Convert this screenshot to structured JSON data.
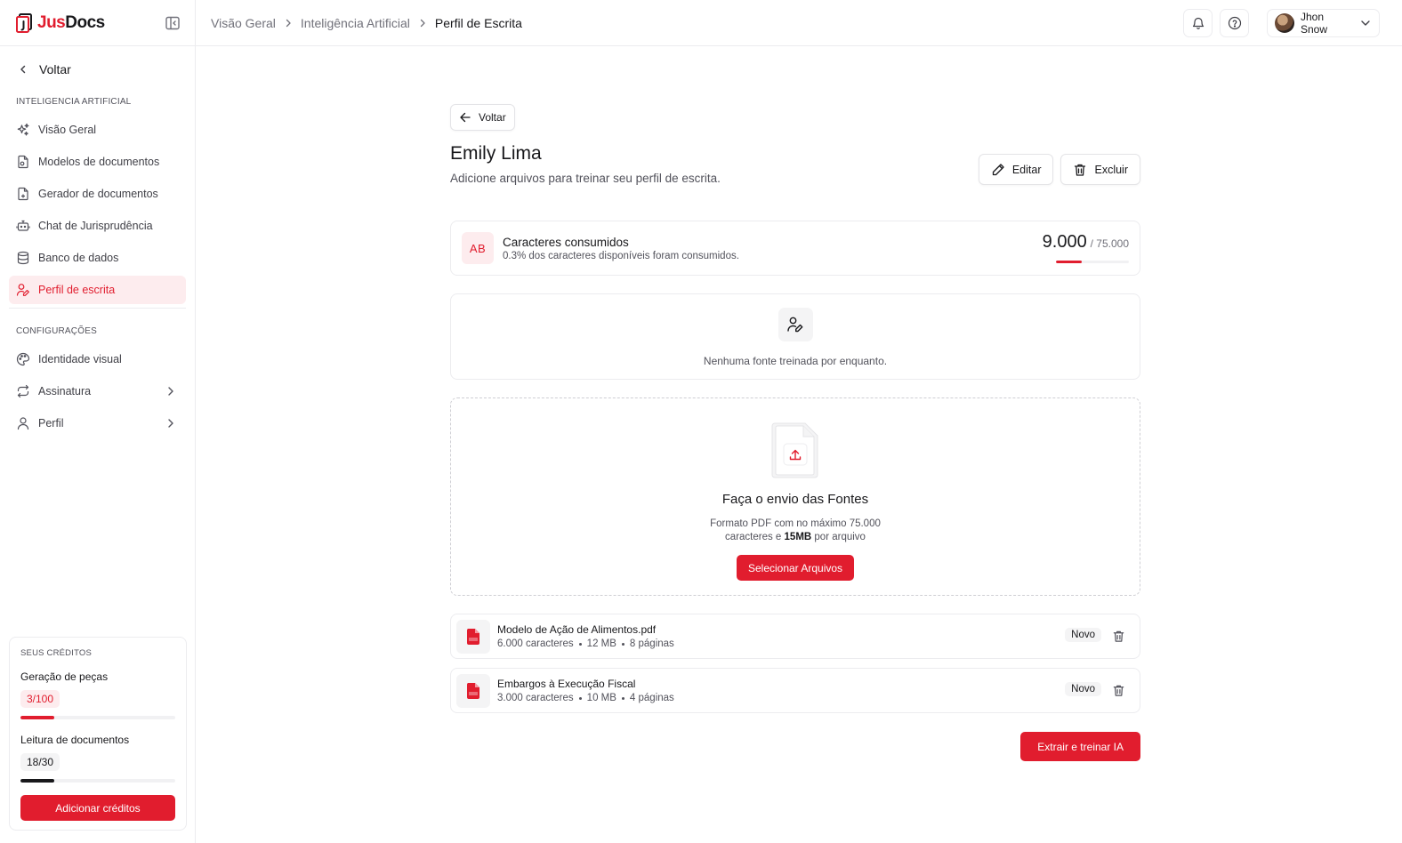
{
  "brand": {
    "name_part1": "Jus",
    "name_part2": "Docs",
    "accent": "#e11d2e"
  },
  "sidebar": {
    "back_label": "Voltar",
    "section_ai": "INTELIGENCIA ARTIFICIAL",
    "ai_items": [
      {
        "label": "Visão Geral",
        "icon": "sparkles-icon"
      },
      {
        "label": "Modelos de documentos",
        "icon": "file-template-icon"
      },
      {
        "label": "Gerador de documentos",
        "icon": "file-generate-icon"
      },
      {
        "label": "Chat de Jurisprudência",
        "icon": "bot-icon"
      },
      {
        "label": "Banco de dados",
        "icon": "database-icon"
      },
      {
        "label": "Perfil de escrita",
        "icon": "user-pen-icon",
        "active": true
      }
    ],
    "section_config": "CONFIGURAÇÕES",
    "config_items": [
      {
        "label": "Identidade visual",
        "icon": "palette-icon"
      },
      {
        "label": "Assinatura",
        "icon": "repeat-icon",
        "has_submenu": true
      },
      {
        "label": "Perfil",
        "icon": "user-icon",
        "has_submenu": true
      }
    ],
    "credits": {
      "label": "SEUS CRÉDITOS",
      "generation": {
        "title": "Geração de peças",
        "value": "3/100",
        "used": 3,
        "total": 100
      },
      "reading": {
        "title": "Leitura de documentos",
        "value": "18/30",
        "used": 18,
        "total": 30
      },
      "add_button": "Adicionar créditos"
    }
  },
  "topbar": {
    "breadcrumbs": [
      "Visão Geral",
      "Inteligência Artificial",
      "Perfil de Escrita"
    ],
    "user_name": "Jhon Snow"
  },
  "main": {
    "back_button": "Voltar",
    "title": "Emily Lima",
    "subtitle": "Adicione arquivos para treinar seu perfil de escrita.",
    "edit_button": "Editar",
    "delete_button": "Excluir",
    "usage": {
      "badge": "AB",
      "title": "Caracteres consumidos",
      "description": "0.3% dos caracteres disponíveis foram consumidos.",
      "used": "9.000",
      "limit": "/ 75.000",
      "progress_pct": 35
    },
    "empty_state": "Nenhuma fonte treinada por enquanto.",
    "upload": {
      "title": "Faça o envio das Fontes",
      "desc_line1": "Formato PDF com no máximo 75.000",
      "desc_line2_pre": "caracteres e ",
      "desc_line2_bold": "15MB",
      "desc_line2_post": " por arquivo",
      "select_button": "Selecionar Arquivos"
    },
    "files": [
      {
        "name": "Modelo de Ação de Alimentos.pdf",
        "chars": "6.000 caracteres",
        "size": "12 MB",
        "pages": "8 páginas",
        "badge": "Novo"
      },
      {
        "name": "Embargos à Execução Fiscal",
        "chars": "3.000 caracteres",
        "size": "10 MB",
        "pages": "4 páginas",
        "badge": "Novo"
      }
    ],
    "train_button": "Extrair e treinar IA"
  }
}
